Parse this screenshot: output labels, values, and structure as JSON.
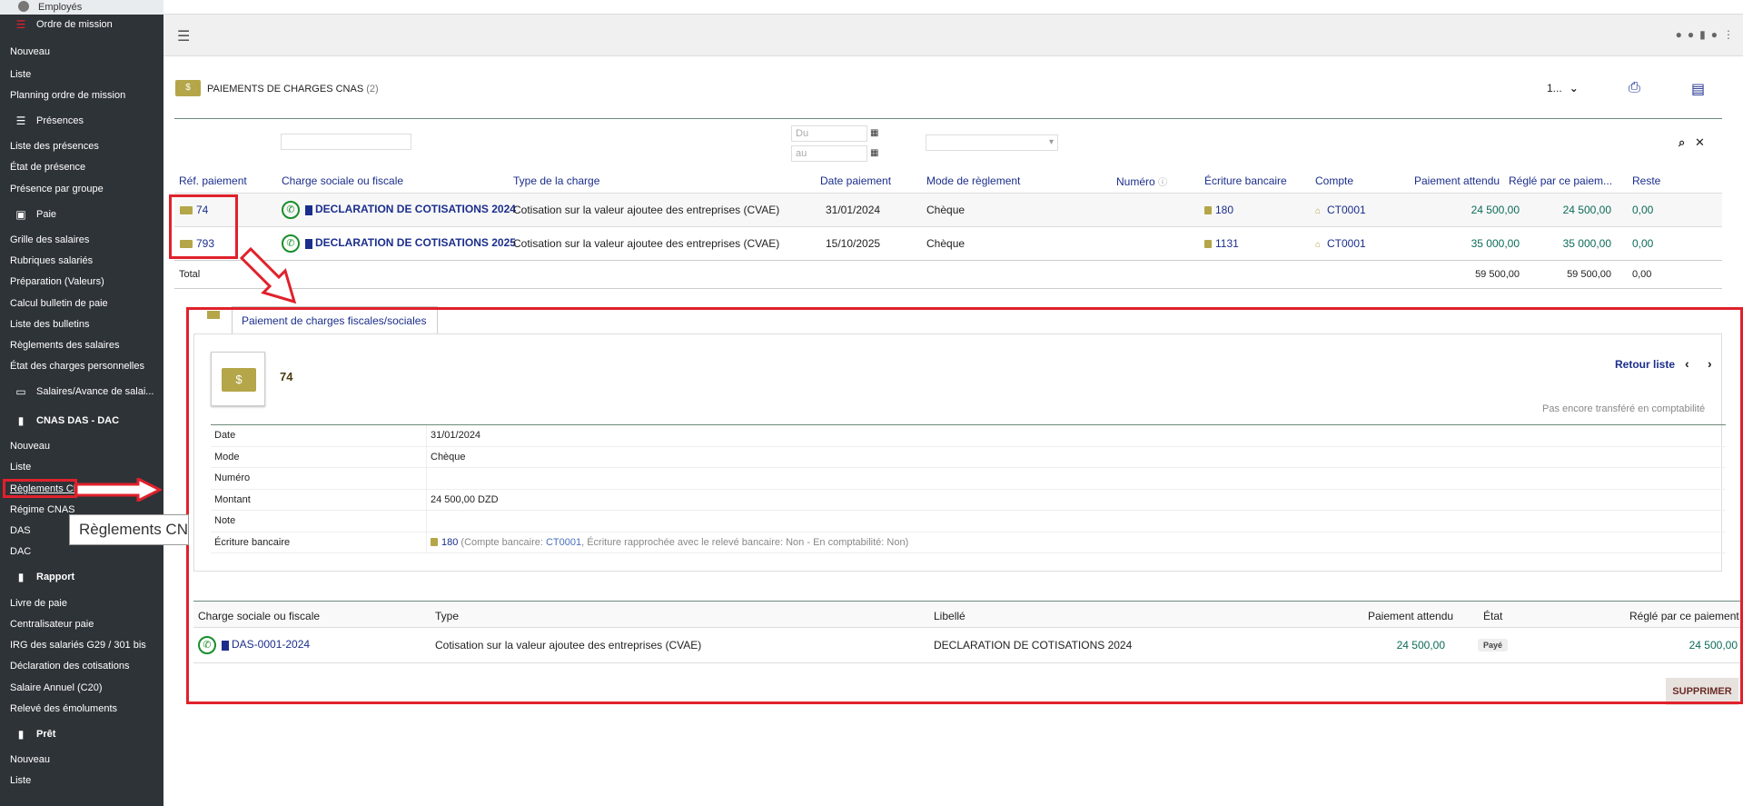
{
  "sidebar": {
    "top_item": "Employés",
    "groups": [
      {
        "title": "Ordre de mission",
        "items": [
          "Nouveau",
          "Liste",
          "Planning ordre de mission"
        ]
      },
      {
        "title": "Présences",
        "items": [
          "Liste des présences",
          "État de présence",
          "Présence par groupe"
        ]
      },
      {
        "title": "Paie",
        "items": [
          "Grille des salaires",
          "Rubriques salariés",
          "Préparation (Valeurs)",
          "Calcul bulletin de paie",
          "Liste des bulletins",
          "Règlements des salaires",
          "État des charges personnelles"
        ]
      },
      {
        "title": "Salaires/Avance de salai...",
        "items": []
      },
      {
        "title": "CNAS DAS - DAC",
        "items": [
          "Nouveau",
          "Liste",
          "Règlements CNAS",
          "Régime CNAS",
          "DAS",
          "DAC"
        ]
      },
      {
        "title": "Rapport",
        "items": [
          "Livre de paie",
          "Centralisateur paie",
          "IRG des salariés G29 / 301 bis",
          "Déclaration des cotisations",
          "Salaire Annuel (C20)",
          "Relevé des émoluments"
        ]
      },
      {
        "title": "Prêt",
        "items": [
          "Nouveau",
          "Liste"
        ]
      }
    ],
    "tooltip": "Règlements CNAS"
  },
  "page": {
    "title": "PAIEMENTS DE CHARGES CNAS",
    "count": "(2)",
    "pager_value": "1...",
    "icon_text": "$"
  },
  "filters": {
    "date_from_placeholder": "Du",
    "date_to_placeholder": "au"
  },
  "list": {
    "columns": [
      "Réf. paiement",
      "Charge sociale ou fiscale",
      "Type de la charge",
      "Date paiement",
      "Mode de règlement",
      "Numéro",
      "Écriture bancaire",
      "Compte",
      "Paiement attendu",
      "Réglé par ce paiem...",
      "Reste"
    ],
    "rows": [
      {
        "ref": "74",
        "charge": "DECLARATION DE COTISATIONS 2024",
        "type": "Cotisation sur la valeur ajoutee des entreprises (CVAE)",
        "date": "31/01/2024",
        "mode": "Chèque",
        "numero": "",
        "ecriture": "180",
        "compte": "CT0001",
        "attendu": "24 500,00",
        "regle": "24 500,00",
        "reste": "0,00"
      },
      {
        "ref": "793",
        "charge": "DECLARATION DE COTISATIONS 2025",
        "type": "Cotisation sur la valeur ajoutee des entreprises (CVAE)",
        "date": "15/10/2025",
        "mode": "Chèque",
        "numero": "",
        "ecriture": "1131",
        "compte": "CT0001",
        "attendu": "35 000,00",
        "regle": "35 000,00",
        "reste": "0,00"
      }
    ],
    "total": {
      "label": "Total",
      "attendu": "59 500,00",
      "regle": "59 500,00",
      "reste": "0,00"
    }
  },
  "detail": {
    "tab_label": "Paiement de charges fiscales/sociales",
    "ref": "74",
    "retour": "Retour liste",
    "status_note": "Pas encore transféré en comptabilité",
    "fields": [
      {
        "label": "Date",
        "value": "31/01/2024"
      },
      {
        "label": "Mode",
        "value": "Chèque"
      },
      {
        "label": "Numéro",
        "value": ""
      },
      {
        "label": "Montant",
        "value": "24 500,00 DZD"
      },
      {
        "label": "Note",
        "value": ""
      }
    ],
    "ecriture": {
      "label": "Écriture bancaire",
      "num": "180",
      "pre": "(Compte bancaire: ",
      "compte": "CT0001",
      "post": ", Écriture rapprochée avec le relevé bancaire: Non - En comptabilité: Non)"
    },
    "sub_columns": [
      "Charge sociale ou fiscale",
      "Type",
      "Libellé",
      "Paiement attendu",
      "État",
      "Réglé par ce paiement"
    ],
    "sub_row": {
      "ref": "DAS-0001-2024",
      "type": "Cotisation sur la valeur ajoutee des entreprises (CVAE)",
      "libelle": "DECLARATION DE COTISATIONS 2024",
      "attendu": "24 500,00",
      "etat": "Payé",
      "regle": "24 500,00"
    },
    "delete_label": "SUPPRIMER"
  },
  "colors": {
    "accent": "#b4a649",
    "link": "#1b2e8c",
    "amount": "#0d6b57",
    "highlight": "#e0212b",
    "sidebar": "#2e3338"
  }
}
